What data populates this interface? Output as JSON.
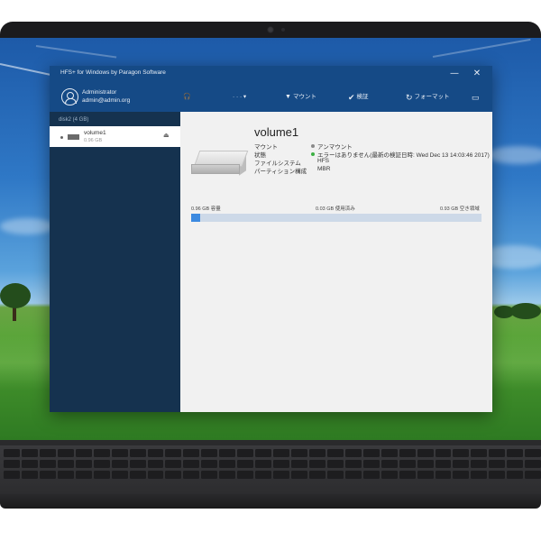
{
  "window": {
    "title": "HFS+ for Windows by Paragon Software",
    "minimize_glyph": "—",
    "close_glyph": "✕"
  },
  "user": {
    "name": "Administrator",
    "email": "admin@admin.org",
    "icon": "user-circle-icon"
  },
  "toolbar": {
    "help_glyph": "🎧",
    "more_label": "· · · ▾",
    "mount_glyph": "▼",
    "mount_label": "マウント",
    "verify_glyph": "✔",
    "verify_label": "検証",
    "format_glyph": "↻",
    "format_label": "フォーマット",
    "panel_glyph": "▭"
  },
  "sidebar": {
    "disk_label": "disk2 (4 GB)",
    "volumes": [
      {
        "name": "volume1",
        "size": "0.96 GB",
        "eject_glyph": "⏏"
      }
    ]
  },
  "volume": {
    "title": "volume1",
    "properties": [
      {
        "label": "マウント",
        "value": "アンマウント",
        "dot_color": "#8a8a8a"
      },
      {
        "label": "状態",
        "value": "エラーはありません(最新の検証日時: Wed Dec 13 14:03:46 2017)",
        "dot_color": "#3cb043"
      },
      {
        "label": "ファイルシステム",
        "value": "HFS",
        "dot_color": ""
      },
      {
        "label": "パーティション構成",
        "value": "MBR",
        "dot_color": ""
      }
    ]
  },
  "usage": {
    "capacity_label": "0.96 GB 容量",
    "used_label": "0.03 GB 使用済み",
    "free_label": "0.93 GB 空き領域",
    "used_fraction": 0.03125
  }
}
